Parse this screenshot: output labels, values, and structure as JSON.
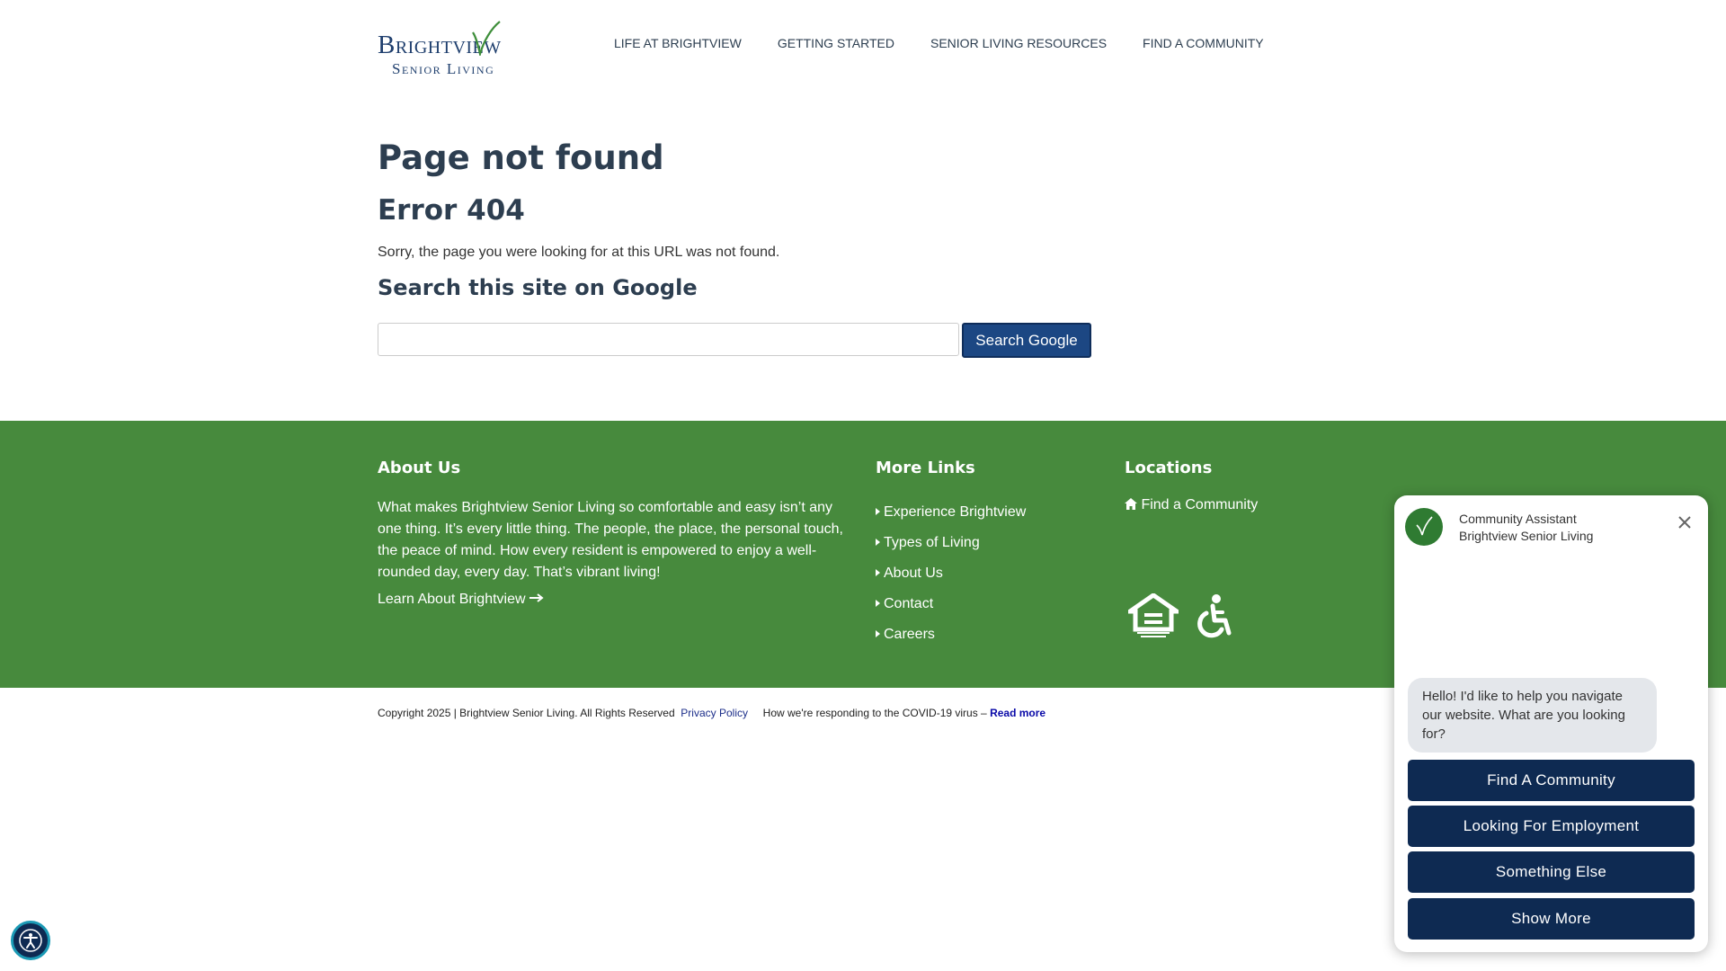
{
  "header": {
    "logo_brand": "Brightview",
    "logo_sub": "Senior Living",
    "nav": [
      "LIFE AT BRIGHTVIEW",
      "GETTING STARTED",
      "SENIOR LIVING RESOURCES",
      "FIND A COMMUNITY"
    ]
  },
  "main": {
    "title": "Page not found",
    "error": "Error 404",
    "message": "Sorry, the page you were looking for at this URL was not found.",
    "search_heading": "Search this site on Google",
    "search_value": "",
    "search_button": "Search Google"
  },
  "footer": {
    "about_heading": "About Us",
    "about_text": "What makes Brightview Senior Living so comfortable and easy isn’t any one thing. It’s every little thing. The people, the place, the personal touch, the peace of mind. How every resident is empowered to enjoy a well-rounded day, every day. That’s vibrant living!",
    "about_link": "Learn About Brightview",
    "links_heading": "More Links",
    "links": [
      "Experience Brightview",
      "Types of Living",
      "About Us",
      "Contact",
      "Careers"
    ],
    "locations_heading": "Locations",
    "locations_link": "Find a Community"
  },
  "bottom": {
    "copyright": "Copyright 2025 | Brightview Senior Living. All Rights Reserved",
    "privacy": "Privacy Policy",
    "covid": "How we're responding to the COVID-19 virus –",
    "read_more": "Read more"
  },
  "chat": {
    "title_line1": "Community Assistant",
    "title_line2": "Brightview Senior Living",
    "message": "Hello! I'd like to help you navigate our website. What are you looking for?",
    "options": [
      "Find A Community",
      "Looking For Employment",
      "Something Else",
      "Show More"
    ]
  },
  "colors": {
    "brand_blue": "#1f3f6e",
    "brand_green": "#478a3d",
    "button_navy": "#0e2a52"
  },
  "icons": [
    "leaf-check-icon",
    "arrow-right-icon",
    "caret-right-icon",
    "home-icon",
    "equal-housing-icon",
    "wheelchair-icon",
    "close-icon",
    "accessibility-icon"
  ]
}
